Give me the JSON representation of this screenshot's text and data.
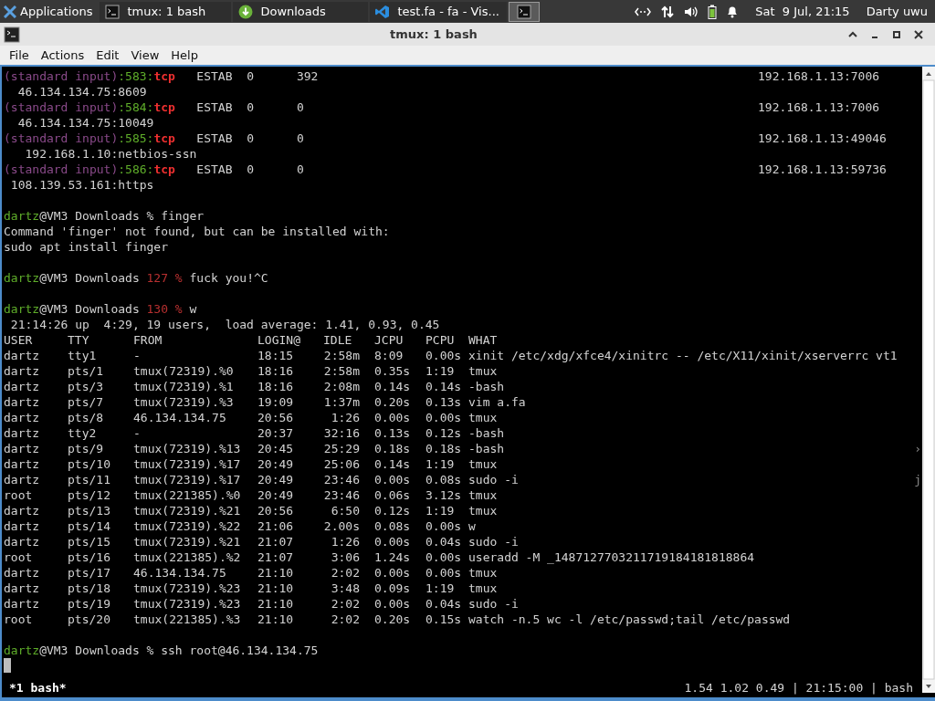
{
  "panel": {
    "menu_label": "Applications",
    "tasks": [
      {
        "label": "tmux: 1 bash",
        "kind": "terminal",
        "selected": false
      },
      {
        "label": "Downloads",
        "kind": "download",
        "selected": false
      },
      {
        "label": "test.fa - fa - Vis...",
        "kind": "editor",
        "selected": false
      },
      {
        "kind": "terminal",
        "selected": true
      }
    ],
    "clock": "Sat  9 Jul, 21:15",
    "user": "Darty uwu"
  },
  "window": {
    "title": "tmux: 1 bash"
  },
  "menu": [
    "File",
    "Actions",
    "Edit",
    "View",
    "Help"
  ],
  "terminal": {
    "lines": [
      {
        "kind": "text",
        "segments": [
          {
            "text": "(standard input)",
            "kind": "file"
          },
          {
            "text": ":583:",
            "kind": "match"
          },
          {
            "text": "tcp",
            "kind": "proto"
          },
          {
            "text": "   ESTAB  0      392",
            "kind": "plain"
          }
        ],
        "right": "192.168.1.13:7006"
      },
      {
        "kind": "text",
        "segments": [
          {
            "text": "  46.134.134.75:8609",
            "kind": "plain"
          }
        ]
      },
      {
        "kind": "text",
        "segments": [
          {
            "text": "(standard input)",
            "kind": "file"
          },
          {
            "text": ":584:",
            "kind": "match"
          },
          {
            "text": "tcp",
            "kind": "proto"
          },
          {
            "text": "   ESTAB  0      0",
            "kind": "plain"
          }
        ],
        "right": "192.168.1.13:7006"
      },
      {
        "kind": "text",
        "segments": [
          {
            "text": "  46.134.134.75:10049",
            "kind": "plain"
          }
        ]
      },
      {
        "kind": "text",
        "segments": [
          {
            "text": "(standard input)",
            "kind": "file"
          },
          {
            "text": ":585:",
            "kind": "match"
          },
          {
            "text": "tcp",
            "kind": "proto"
          },
          {
            "text": "   ESTAB  0      0",
            "kind": "plain"
          }
        ],
        "right": "192.168.1.13:49046"
      },
      {
        "kind": "text",
        "segments": [
          {
            "text": "   192.168.1.10:netbios-ssn",
            "kind": "plain"
          }
        ]
      },
      {
        "kind": "text",
        "segments": [
          {
            "text": "(standard input)",
            "kind": "file"
          },
          {
            "text": ":586:",
            "kind": "match"
          },
          {
            "text": "tcp",
            "kind": "proto"
          },
          {
            "text": "   ESTAB  0      0",
            "kind": "plain"
          }
        ],
        "right": "192.168.1.13:59736"
      },
      {
        "kind": "text",
        "segments": [
          {
            "text": " 108.139.53.161:https",
            "kind": "plain"
          }
        ]
      },
      {
        "kind": "blank"
      },
      {
        "kind": "text",
        "segments": [
          {
            "text": "dartz",
            "kind": "user"
          },
          {
            "text": "@VM3 Downloads % finger",
            "kind": "plain"
          }
        ]
      },
      {
        "kind": "text",
        "segments": [
          {
            "text": "Command 'finger' not found, but can be installed with:",
            "kind": "plain"
          }
        ]
      },
      {
        "kind": "text",
        "segments": [
          {
            "text": "sudo apt install finger",
            "kind": "plain"
          }
        ]
      },
      {
        "kind": "blank"
      },
      {
        "kind": "text",
        "segments": [
          {
            "text": "dartz",
            "kind": "user"
          },
          {
            "text": "@VM3 Downloads ",
            "kind": "plain"
          },
          {
            "text": "127 %",
            "kind": "error"
          },
          {
            "text": " fuck you!^C",
            "kind": "plain"
          }
        ]
      },
      {
        "kind": "blank"
      },
      {
        "kind": "text",
        "segments": [
          {
            "text": "dartz",
            "kind": "user"
          },
          {
            "text": "@VM3 Downloads ",
            "kind": "plain"
          },
          {
            "text": "130 %",
            "kind": "error"
          },
          {
            "text": " w",
            "kind": "plain"
          }
        ]
      },
      {
        "kind": "text",
        "segments": [
          {
            "text": " 21:14:26 up  4:29, 19 users,  load average: 1.41, 0.93, 0.45",
            "kind": "plain"
          }
        ]
      },
      {
        "kind": "table",
        "columns": [
          "USER",
          "TTY",
          "FROM",
          "LOGIN@",
          "IDLE",
          "JCPU",
          "PCPU",
          "WHAT"
        ],
        "rows": [
          {
            "cells": [
              "dartz",
              "tty1",
              "-",
              "18:15",
              "2:58m",
              "8:09",
              "0.00s",
              "xinit /etc/xdg/xfce4/xinitrc -- /etc/X11/xinit/xserverrc vt1"
            ]
          },
          {
            "cells": [
              "dartz",
              "pts/1",
              "tmux(72319).%0",
              "18:16",
              "2:58m",
              "0.35s",
              "1:19",
              "tmux"
            ]
          },
          {
            "cells": [
              "dartz",
              "pts/3",
              "tmux(72319).%1",
              "18:16",
              "2:08m",
              "0.14s",
              "0.14s",
              "-bash"
            ]
          },
          {
            "cells": [
              "dartz",
              "pts/7",
              "tmux(72319).%3",
              "19:09",
              "1:37m",
              "0.20s",
              "0.13s",
              "vim a.fa"
            ]
          },
          {
            "cells": [
              "dartz",
              "pts/8",
              "46.134.134.75",
              "20:56",
              "1:26",
              "0.00s",
              "0.00s",
              "tmux"
            ]
          },
          {
            "cells": [
              "dartz",
              "tty2",
              "-",
              "20:37",
              "32:16",
              "0.13s",
              "0.12s",
              "-bash"
            ]
          },
          {
            "cells": [
              "dartz",
              "pts/9",
              "tmux(72319).%13",
              "20:45",
              "25:29",
              "0.18s",
              "0.18s",
              "-bash"
            ],
            "edge": "›"
          },
          {
            "cells": [
              "dartz",
              "pts/10",
              "tmux(72319).%17",
              "20:49",
              "25:06",
              "0.14s",
              "1:19",
              "tmux"
            ]
          },
          {
            "cells": [
              "dartz",
              "pts/11",
              "tmux(72319).%17",
              "20:49",
              "23:46",
              "0.00s",
              "0.08s",
              "sudo -i"
            ],
            "edge": "j"
          },
          {
            "cells": [
              "root",
              "pts/12",
              "tmux(221385).%0",
              "20:49",
              "23:46",
              "0.06s",
              "3.12s",
              "tmux"
            ]
          },
          {
            "cells": [
              "dartz",
              "pts/13",
              "tmux(72319).%21",
              "20:56",
              "6:50",
              "0.12s",
              "1:19",
              "tmux"
            ]
          },
          {
            "cells": [
              "dartz",
              "pts/14",
              "tmux(72319).%22",
              "21:06",
              "2.00s",
              "0.08s",
              "0.00s",
              "w"
            ]
          },
          {
            "cells": [
              "dartz",
              "pts/15",
              "tmux(72319).%21",
              "21:07",
              "1:26",
              "0.00s",
              "0.04s",
              "sudo -i"
            ]
          },
          {
            "cells": [
              "root",
              "pts/16",
              "tmux(221385).%2",
              "21:07",
              "3:06",
              "1.24s",
              "0.00s",
              "useradd -M _1487127703211719184181818864"
            ]
          },
          {
            "cells": [
              "dartz",
              "pts/17",
              "46.134.134.75",
              "21:10",
              "2:02",
              "0.00s",
              "0.00s",
              "tmux"
            ]
          },
          {
            "cells": [
              "dartz",
              "pts/18",
              "tmux(72319).%23",
              "21:10",
              "3:48",
              "0.09s",
              "1:19",
              "tmux"
            ]
          },
          {
            "cells": [
              "dartz",
              "pts/19",
              "tmux(72319).%23",
              "21:10",
              "2:02",
              "0.00s",
              "0.04s",
              "sudo -i"
            ]
          },
          {
            "cells": [
              "root",
              "pts/20",
              "tmux(221385).%3",
              "21:10",
              "2:02",
              "0.20s",
              "0.15s",
              "watch -n.5 wc -l /etc/passwd;tail /etc/passwd"
            ]
          }
        ]
      },
      {
        "kind": "blank"
      },
      {
        "kind": "text",
        "segments": [
          {
            "text": "dartz",
            "kind": "user"
          },
          {
            "text": "@VM3 Downloads % ssh root@46.134.134.75",
            "kind": "plain"
          }
        ]
      },
      {
        "kind": "cursor"
      }
    ]
  },
  "status_bar": {
    "window": "*1 bash*",
    "info": "1.54 1.02 0.49 | 21:15:00 | bash"
  }
}
